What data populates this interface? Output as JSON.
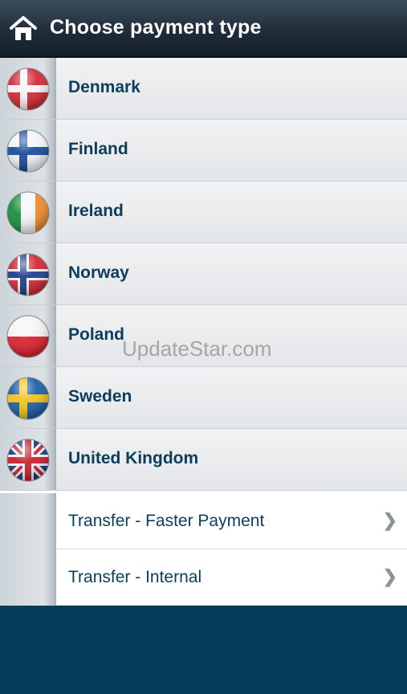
{
  "header": {
    "title": "Choose payment type",
    "home_icon": "home-icon"
  },
  "countries": [
    {
      "label": "Denmark",
      "flag_icon": "denmark-flag-icon"
    },
    {
      "label": "Finland",
      "flag_icon": "finland-flag-icon"
    },
    {
      "label": "Ireland",
      "flag_icon": "ireland-flag-icon"
    },
    {
      "label": "Norway",
      "flag_icon": "norway-flag-icon"
    },
    {
      "label": "Poland",
      "flag_icon": "poland-flag-icon"
    },
    {
      "label": "Sweden",
      "flag_icon": "sweden-flag-icon"
    },
    {
      "label": "United Kingdom",
      "flag_icon": "united-kingdom-flag-icon"
    }
  ],
  "transfers": [
    {
      "label": "Transfer - Faster Payment",
      "chevron": "❯"
    },
    {
      "label": "Transfer - Internal",
      "chevron": "❯"
    }
  ],
  "watermark": "UpdateStar.com",
  "colors": {
    "header": "#1f2d39",
    "text": "#0d3d5c",
    "footer": "#073b5c"
  }
}
